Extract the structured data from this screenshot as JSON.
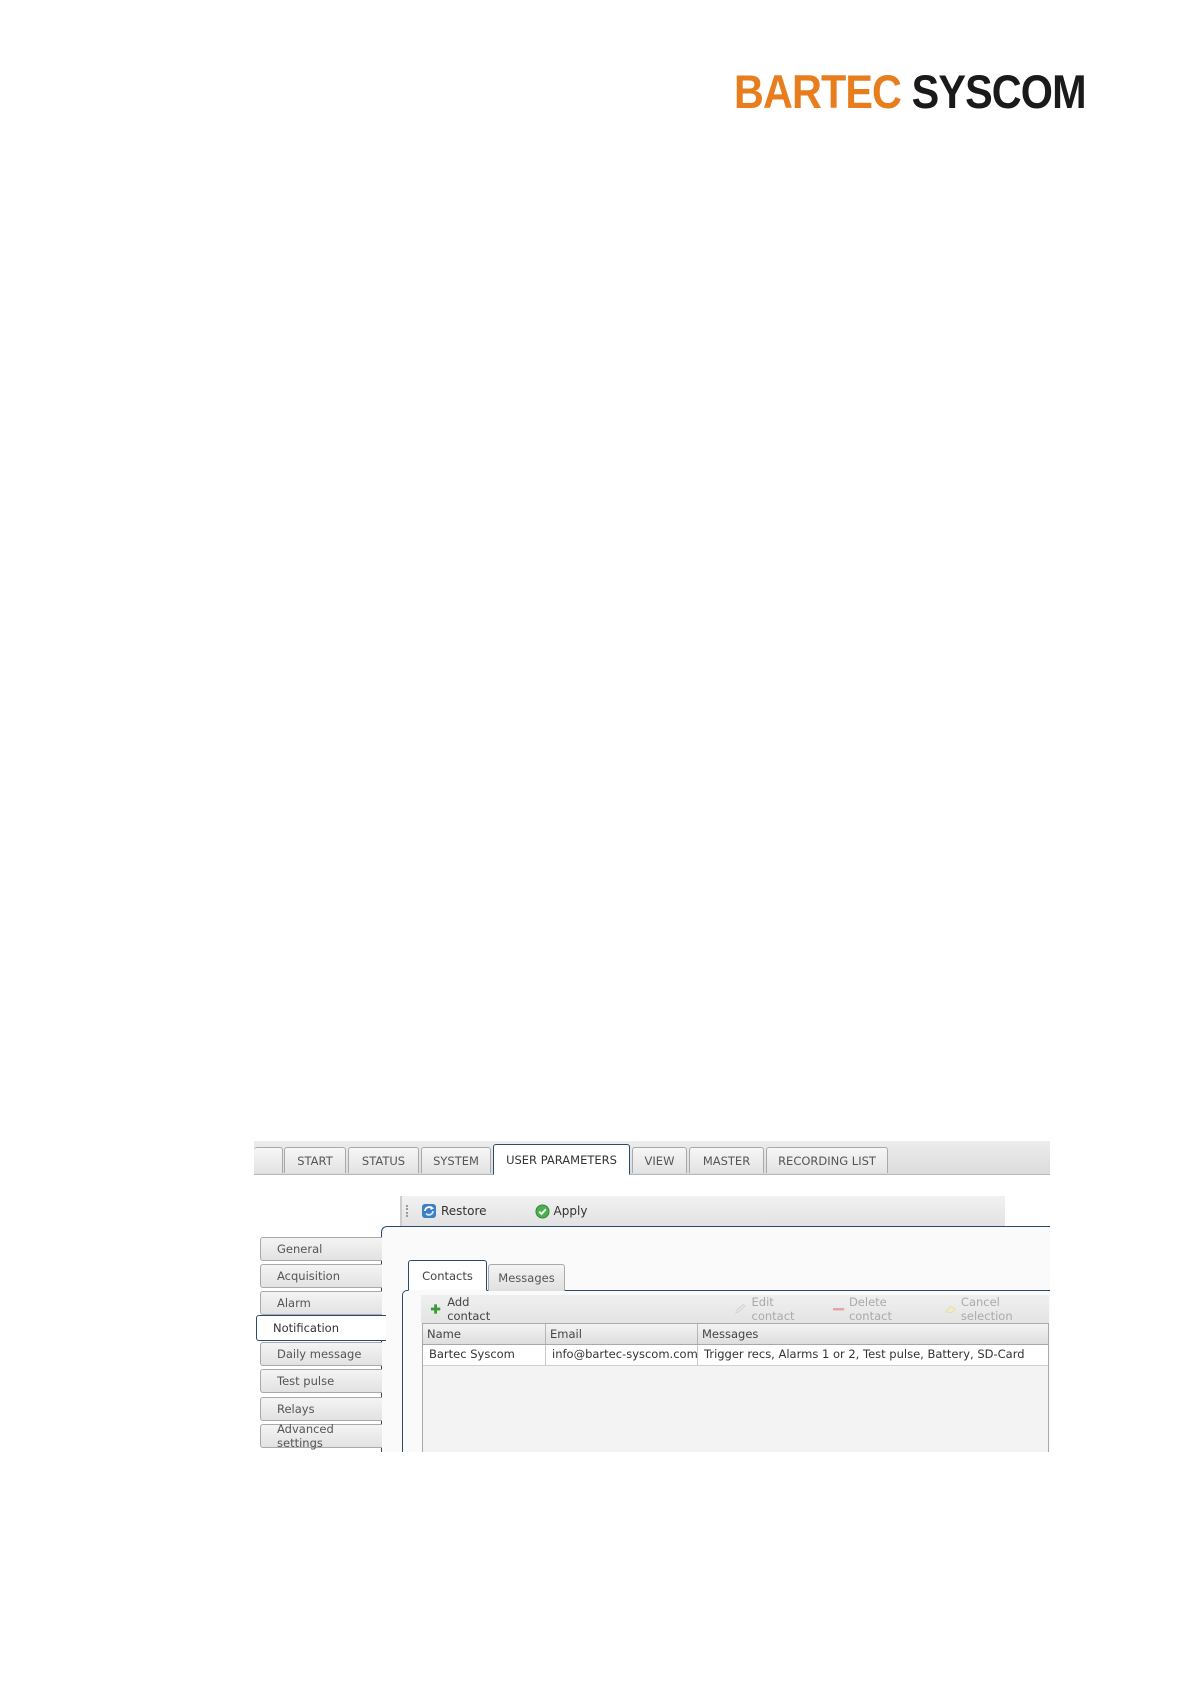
{
  "brand": {
    "part1": "BARTEC",
    "part2": "SYSCOM",
    "color_primary": "#e87d1e",
    "color_secondary": "#1a1a1a"
  },
  "main_tabs": [
    {
      "label": "START"
    },
    {
      "label": "STATUS"
    },
    {
      "label": "SYSTEM"
    },
    {
      "label": "USER PARAMETERS",
      "active": true
    },
    {
      "label": "VIEW"
    },
    {
      "label": "MASTER"
    },
    {
      "label": "RECORDING LIST"
    }
  ],
  "toolbar": {
    "restore_label": "Restore",
    "restore_icon": "refresh-icon",
    "apply_label": "Apply",
    "apply_icon": "check-circle-icon"
  },
  "sidebar": {
    "items": [
      {
        "label": "General"
      },
      {
        "label": "Acquisition"
      },
      {
        "label": "Alarm"
      },
      {
        "label": "Notification",
        "active": true
      },
      {
        "label": "Daily message"
      },
      {
        "label": "Test pulse"
      },
      {
        "label": "Relays"
      },
      {
        "label": "Advanced settings"
      }
    ]
  },
  "subtabs": [
    {
      "label": "Contacts",
      "active": true
    },
    {
      "label": "Messages"
    }
  ],
  "grid_toolbar": {
    "add_label": "Add contact",
    "edit_label": "Edit contact",
    "delete_label": "Delete contact",
    "cancel_label": "Cancel selection"
  },
  "grid": {
    "columns": [
      "Name",
      "Email",
      "Messages"
    ],
    "rows": [
      [
        "Bartec Syscom",
        "info@bartec-syscom.com",
        "Trigger recs, Alarms 1 or 2, Test pulse, Battery, SD-Card"
      ]
    ]
  },
  "colors": {
    "frame_border": "#2a4a6b",
    "add_green": "#3a9a3a",
    "delete_red": "#e08a8a"
  }
}
